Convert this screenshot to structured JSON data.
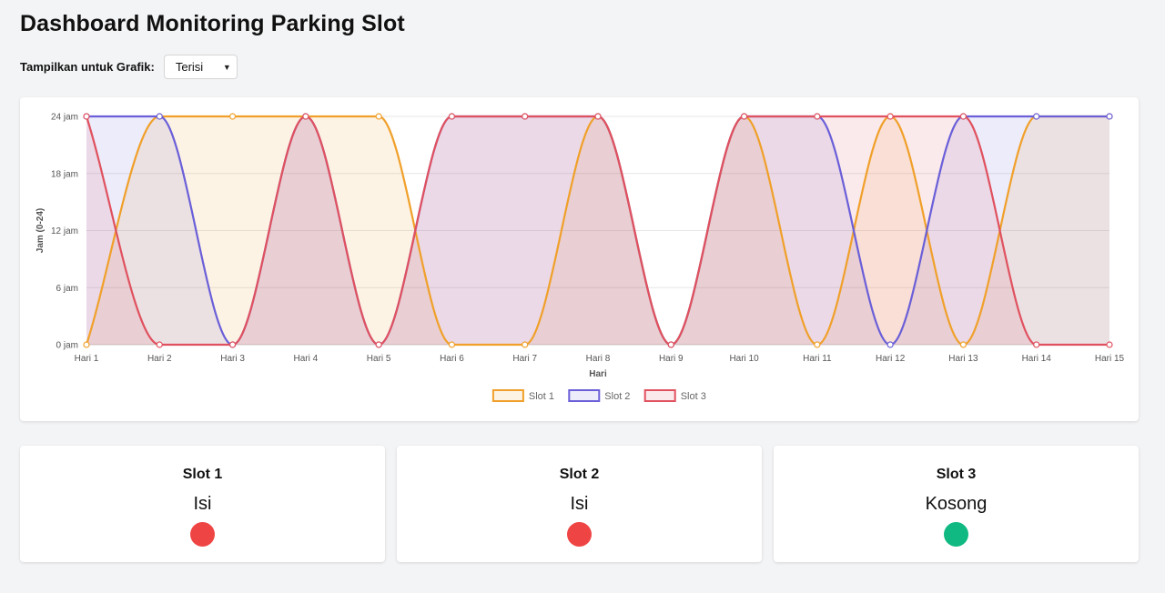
{
  "page": {
    "title": "Dashboard Monitoring Parking Slot"
  },
  "filter": {
    "label": "Tampilkan untuk Grafik:",
    "selected": "Terisi"
  },
  "chart_data": {
    "type": "area",
    "title": "",
    "xlabel": "Hari",
    "ylabel": "Jam (0-24)",
    "ylim": [
      0,
      24
    ],
    "yticks": [
      "0 jam",
      "6 jam",
      "12 jam",
      "18 jam",
      "24 jam"
    ],
    "ytick_values": [
      0,
      6,
      12,
      18,
      24
    ],
    "categories": [
      "Hari 1",
      "Hari 2",
      "Hari 3",
      "Hari 4",
      "Hari 5",
      "Hari 6",
      "Hari 7",
      "Hari 8",
      "Hari 9",
      "Hari 10",
      "Hari 11",
      "Hari 12",
      "Hari 13",
      "Hari 14",
      "Hari 15"
    ],
    "grid": true,
    "legend_position": "bottom",
    "series": [
      {
        "name": "Slot 1",
        "color": "#f0a02a",
        "values": [
          0,
          24,
          24,
          24,
          24,
          0,
          0,
          24,
          0,
          24,
          0,
          24,
          0,
          24,
          24
        ]
      },
      {
        "name": "Slot 2",
        "color": "#6a5fd8",
        "values": [
          24,
          24,
          0,
          24,
          0,
          24,
          24,
          24,
          0,
          24,
          24,
          0,
          24,
          24,
          24
        ]
      },
      {
        "name": "Slot 3",
        "color": "#e0515f",
        "values": [
          24,
          0,
          0,
          24,
          0,
          24,
          24,
          24,
          0,
          24,
          24,
          24,
          24,
          0,
          0
        ]
      }
    ]
  },
  "slots": [
    {
      "name": "Slot 1",
      "status": "Isi",
      "dot_color": "#ef4444"
    },
    {
      "name": "Slot 2",
      "status": "Isi",
      "dot_color": "#ef4444"
    },
    {
      "name": "Slot 3",
      "status": "Kosong",
      "dot_color": "#10b981"
    }
  ]
}
